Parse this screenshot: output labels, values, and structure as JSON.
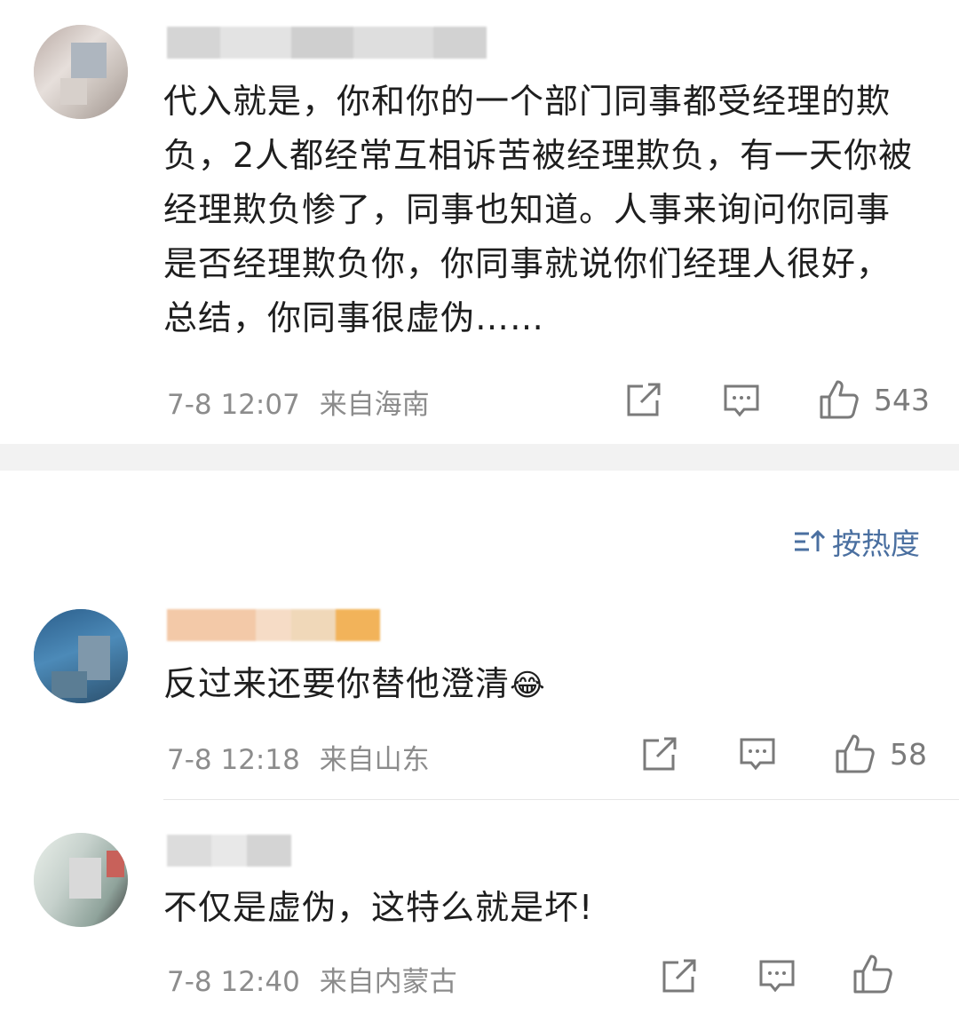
{
  "comments": [
    {
      "text": "代入就是，你和你的一个部门同事都受经理的欺负，2人都经常互相诉苦被经理欺负，有一天你被经理欺负惨了，同事也知道。人事来询问你同事是否经理欺负你，你同事就说你们经理人很好，总结，你同事很虚伪……",
      "time": "7-8 12:07",
      "location": "来自海南",
      "likes": "543"
    },
    {
      "text": "反过来还要你替他澄清",
      "emoji": "😂",
      "time": "7-8 12:18",
      "location": "来自山东",
      "likes": "58"
    },
    {
      "text": "不仅是虚伪，这特么就是坏!",
      "time": "7-8 12:40",
      "location": "来自内蒙古",
      "likes": ""
    }
  ],
  "sort": {
    "label": "按热度"
  },
  "icons": {
    "share": "share-icon",
    "reply": "comment-icon",
    "like": "thumbs-up-icon",
    "sort": "sort-icon"
  },
  "colors": {
    "meta": "#8c8c8c",
    "sort": "#4a6fa0",
    "separator": "#f2f2f2"
  }
}
